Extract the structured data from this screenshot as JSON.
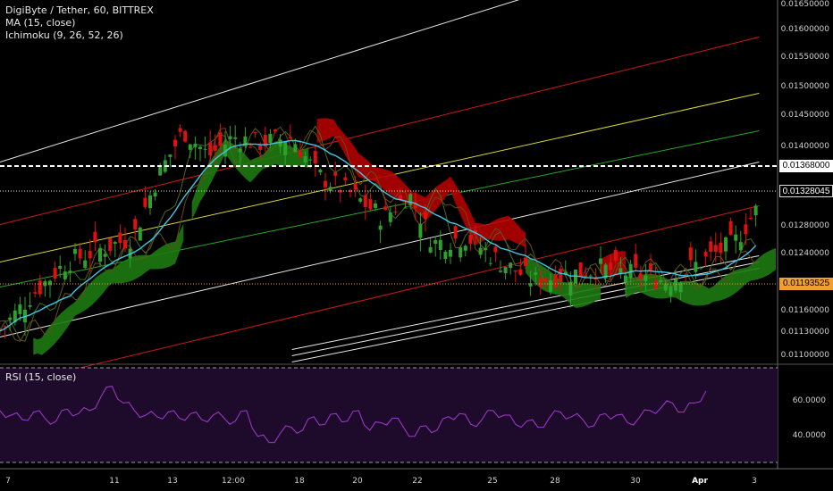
{
  "legend": {
    "title": "DigiByte / Tether, 60, BITTREX",
    "ma": "MA (15, close)",
    "ichimoku": "Ichimoku (9, 26, 52, 26)",
    "rsi": "RSI (15, close)"
  },
  "tags": {
    "white_level": "0.01368000",
    "last_price": "0.01328045",
    "orange_level": "0.01193525"
  },
  "colors": {
    "background": "#000000",
    "up": "#2ea02e",
    "down": "#e01010",
    "ma": "#3ec8e8",
    "cloud_green": "#1d7a12",
    "cloud_red": "#b30000",
    "rsi": "#a43ad0",
    "rsi_band": "#1e0a2a",
    "white_level": "#ffffff",
    "orange_level": "#f0a030"
  },
  "chart_data": [
    {
      "type": "candlestick",
      "title": "DigiByte / Tether, 60, BITTREX",
      "y_ticks": [
        "0.01650000",
        "0.01600000",
        "0.01550000",
        "0.01500000",
        "0.01450000",
        "0.01400000",
        "0.01280000",
        "0.01240000",
        "0.01160000",
        "0.01130000",
        "0.01100000"
      ],
      "x_ticks": [
        "7",
        "11",
        "13",
        "12:00",
        "18",
        "20",
        "22",
        "25",
        "28",
        "30",
        "Apr",
        "3"
      ],
      "ylim": [
        0.01085,
        0.01655
      ],
      "horizontal_levels": [
        {
          "value": 0.01368,
          "style": "dashed",
          "color": "white"
        },
        {
          "value": 0.01328045,
          "style": "dotted",
          "color": "white"
        },
        {
          "value": 0.01193525,
          "style": "dotted",
          "color": "orange"
        }
      ],
      "close_path": [
        {
          "t": 0,
          "v": 0.0113
        },
        {
          "t": 4,
          "v": 0.0119
        },
        {
          "t": 8,
          "v": 0.0124
        },
        {
          "t": 12,
          "v": 0.0126
        },
        {
          "t": 16,
          "v": 0.0128
        },
        {
          "t": 19,
          "v": 0.0138
        },
        {
          "t": 22,
          "v": 0.0145
        },
        {
          "t": 25,
          "v": 0.0141
        },
        {
          "t": 28,
          "v": 0.0144
        },
        {
          "t": 31,
          "v": 0.0143
        },
        {
          "t": 35,
          "v": 0.0144
        },
        {
          "t": 38,
          "v": 0.0138
        },
        {
          "t": 42,
          "v": 0.0135
        },
        {
          "t": 46,
          "v": 0.0131
        },
        {
          "t": 49,
          "v": 0.0135
        },
        {
          "t": 52,
          "v": 0.0127
        },
        {
          "t": 56,
          "v": 0.0128
        },
        {
          "t": 60,
          "v": 0.0124
        },
        {
          "t": 64,
          "v": 0.0121
        },
        {
          "t": 68,
          "v": 0.0122
        },
        {
          "t": 72,
          "v": 0.0123
        },
        {
          "t": 76,
          "v": 0.0122
        },
        {
          "t": 80,
          "v": 0.0121
        },
        {
          "t": 84,
          "v": 0.0124
        },
        {
          "t": 88,
          "v": 0.0127
        },
        {
          "t": 91,
          "v": 0.0133
        }
      ],
      "channel_lines": [
        {
          "color": "white",
          "from": [
            0,
            0.014
          ],
          "to": [
            91,
            0.0178
          ]
        },
        {
          "color": "red",
          "from": [
            0,
            0.013
          ],
          "to": [
            91,
            0.016
          ]
        },
        {
          "color": "yellow",
          "from": [
            0,
            0.0124
          ],
          "to": [
            91,
            0.0151
          ]
        },
        {
          "color": "green",
          "from": [
            0,
            0.012
          ],
          "to": [
            91,
            0.0145
          ]
        },
        {
          "color": "white",
          "from": [
            0,
            0.0112
          ],
          "to": [
            91,
            0.014
          ]
        },
        {
          "color": "red",
          "from": [
            0,
            0.0104
          ],
          "to": [
            91,
            0.0133
          ]
        },
        {
          "color": "white",
          "from": [
            35,
            0.011
          ],
          "to": [
            91,
            0.0125
          ]
        },
        {
          "color": "white",
          "from": [
            35,
            0.0109
          ],
          "to": [
            91,
            0.0124
          ]
        },
        {
          "color": "white",
          "from": [
            35,
            0.0108
          ],
          "to": [
            91,
            0.0123
          ]
        }
      ],
      "cloud": [
        {
          "from": 4,
          "to": 22,
          "color": "green"
        },
        {
          "from": 23,
          "to": 37,
          "color": "green"
        },
        {
          "from": 38,
          "to": 63,
          "color": "red"
        },
        {
          "from": 63,
          "to": 72,
          "color": "green"
        },
        {
          "from": 72,
          "to": 75,
          "color": "red"
        },
        {
          "from": 75,
          "to": 93,
          "color": "green"
        }
      ]
    },
    {
      "type": "line",
      "title": "RSI (15, close)",
      "y_ticks": [
        "60.0000",
        "40.0000"
      ],
      "ylim": [
        22,
        82
      ],
      "series": [
        {
          "values": [
            55,
            52,
            49,
            54,
            50,
            48,
            56,
            53,
            55,
            64,
            71,
            60,
            55,
            52,
            51,
            54,
            50,
            53,
            49,
            52,
            50,
            48,
            55,
            38,
            34,
            40,
            44,
            42,
            51,
            46,
            53,
            48,
            55,
            42,
            47,
            50,
            44,
            38,
            45,
            42,
            51,
            53,
            46,
            49,
            55,
            52,
            46,
            48,
            44,
            50,
            54,
            51,
            49,
            45,
            53,
            52,
            47,
            50,
            55,
            57,
            60,
            54,
            60,
            68
          ]
        }
      ]
    }
  ]
}
